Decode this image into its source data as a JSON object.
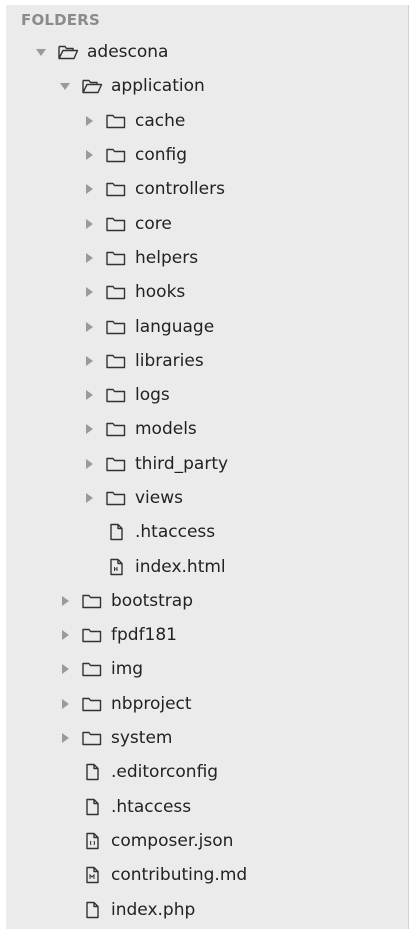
{
  "panel": {
    "header": "FOLDERS"
  },
  "tree": [
    {
      "label": "adescona",
      "type": "folder",
      "open": true,
      "depth": 0
    },
    {
      "label": "application",
      "type": "folder",
      "open": true,
      "depth": 1
    },
    {
      "label": "cache",
      "type": "folder",
      "open": false,
      "depth": 2
    },
    {
      "label": "config",
      "type": "folder",
      "open": false,
      "depth": 2
    },
    {
      "label": "controllers",
      "type": "folder",
      "open": false,
      "depth": 2
    },
    {
      "label": "core",
      "type": "folder",
      "open": false,
      "depth": 2
    },
    {
      "label": "helpers",
      "type": "folder",
      "open": false,
      "depth": 2
    },
    {
      "label": "hooks",
      "type": "folder",
      "open": false,
      "depth": 2
    },
    {
      "label": "language",
      "type": "folder",
      "open": false,
      "depth": 2
    },
    {
      "label": "libraries",
      "type": "folder",
      "open": false,
      "depth": 2
    },
    {
      "label": "logs",
      "type": "folder",
      "open": false,
      "depth": 2
    },
    {
      "label": "models",
      "type": "folder",
      "open": false,
      "depth": 2
    },
    {
      "label": "third_party",
      "type": "folder",
      "open": false,
      "depth": 2
    },
    {
      "label": "views",
      "type": "folder",
      "open": false,
      "depth": 2
    },
    {
      "label": ".htaccess",
      "type": "file",
      "fileIcon": "file-icon",
      "depth": 2
    },
    {
      "label": "index.html",
      "type": "file",
      "fileIcon": "html-file-icon",
      "depth": 2
    },
    {
      "label": "bootstrap",
      "type": "folder",
      "open": false,
      "depth": 1
    },
    {
      "label": "fpdf181",
      "type": "folder",
      "open": false,
      "depth": 1
    },
    {
      "label": "img",
      "type": "folder",
      "open": false,
      "depth": 1
    },
    {
      "label": "nbproject",
      "type": "folder",
      "open": false,
      "depth": 1
    },
    {
      "label": "system",
      "type": "folder",
      "open": false,
      "depth": 1
    },
    {
      "label": ".editorconfig",
      "type": "file",
      "fileIcon": "file-icon",
      "depth": 1
    },
    {
      "label": ".htaccess",
      "type": "file",
      "fileIcon": "file-icon",
      "depth": 1
    },
    {
      "label": "composer.json",
      "type": "file",
      "fileIcon": "json-file-icon",
      "depth": 1
    },
    {
      "label": "contributing.md",
      "type": "file",
      "fileIcon": "markdown-file-icon",
      "depth": 1
    },
    {
      "label": "index.php",
      "type": "file",
      "fileIcon": "file-icon",
      "depth": 1
    }
  ],
  "colors": {
    "panel_background": "#ebebeb",
    "header_text": "#8b8b8b",
    "item_text": "#222222",
    "arrow": "#9a9a9a",
    "icon_stroke": "#333333"
  }
}
